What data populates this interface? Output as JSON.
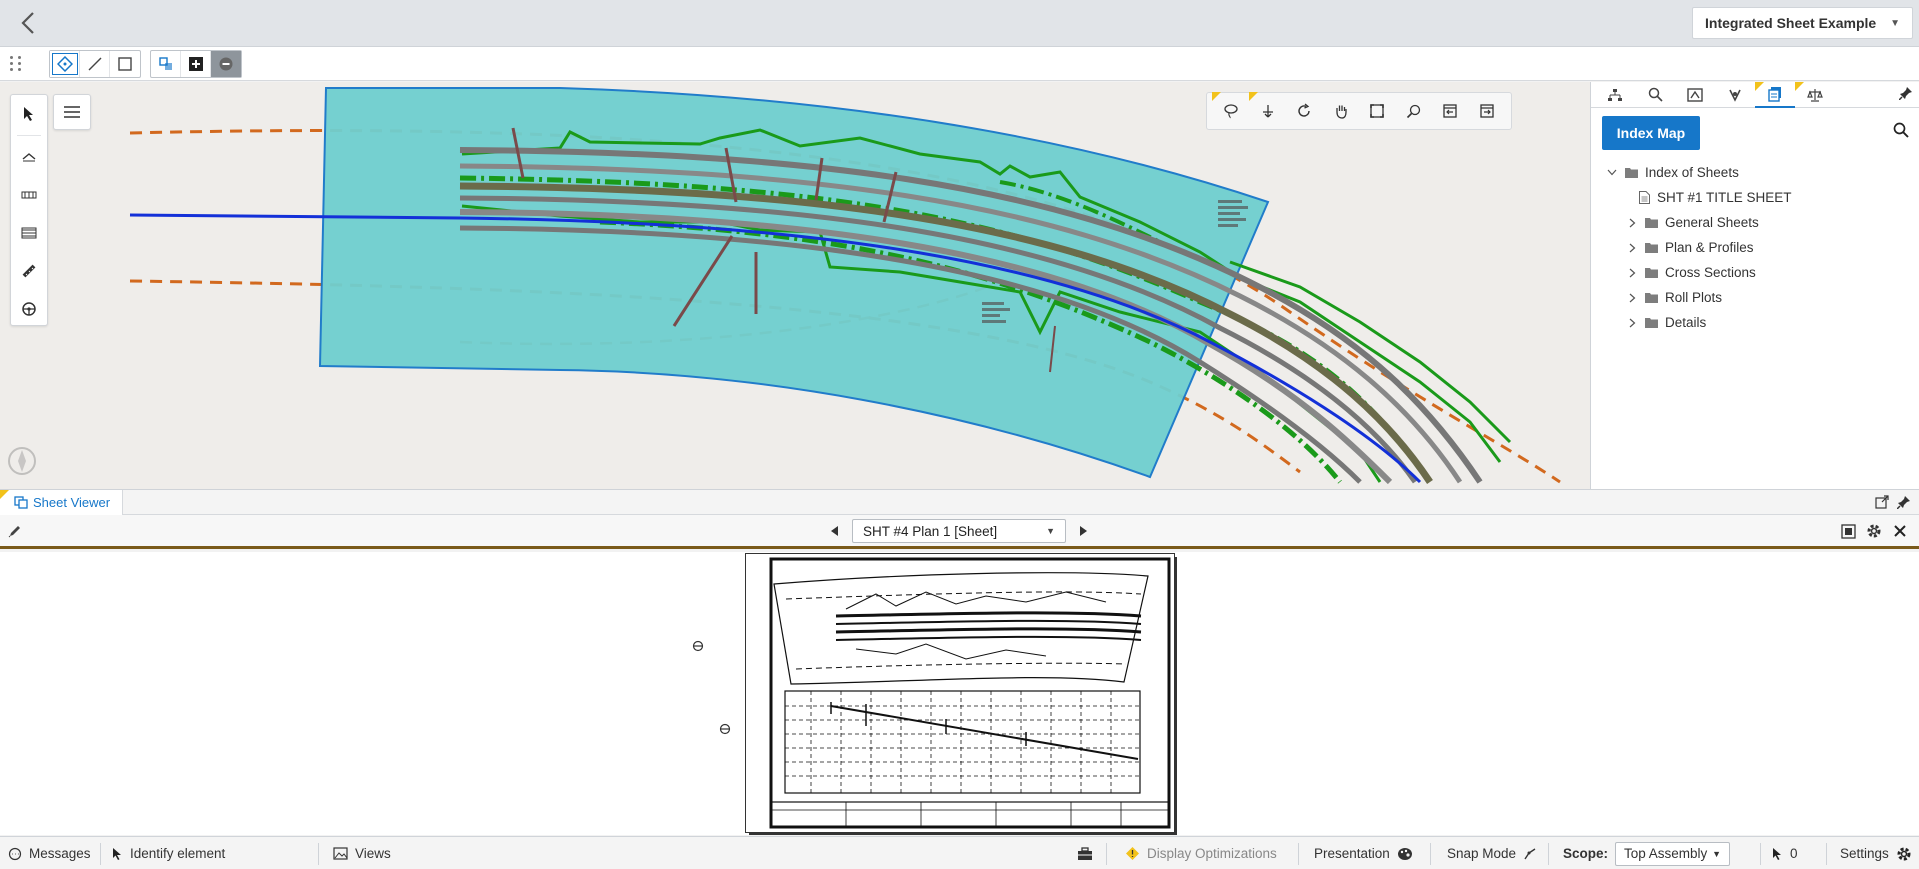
{
  "header": {
    "project_name": "Integrated Sheet Example"
  },
  "toolbar": {
    "icons": [
      "point-select-icon",
      "line-select-icon",
      "box-select-icon",
      "selection-mode-icon",
      "add-selection-icon",
      "remove-selection-icon"
    ]
  },
  "view_tools": [
    "lasso-icon",
    "walk-icon",
    "rotate-icon",
    "pan-icon",
    "fit-view-icon",
    "zoom-window-icon",
    "previous-view-icon",
    "next-view-icon"
  ],
  "right_panel": {
    "index_map_label": "Index Map",
    "tree": [
      {
        "label": "Index of Sheets",
        "level": 0,
        "type": "folder",
        "expanded": true
      },
      {
        "label": "SHT #1 TITLE SHEET",
        "level": 1,
        "type": "sheet"
      },
      {
        "label": "General Sheets",
        "level": 1,
        "type": "folder",
        "expanded": false
      },
      {
        "label": "Plan & Profiles",
        "level": 1,
        "type": "folder",
        "expanded": false
      },
      {
        "label": "Cross Sections",
        "level": 1,
        "type": "folder",
        "expanded": false
      },
      {
        "label": "Roll Plots",
        "level": 1,
        "type": "folder",
        "expanded": false
      },
      {
        "label": "Details",
        "level": 1,
        "type": "folder",
        "expanded": false
      }
    ]
  },
  "sheet_viewer": {
    "tab_label": "Sheet Viewer",
    "current_sheet": "SHT #4 Plan 1 [Sheet]"
  },
  "statusbar": {
    "messages": "Messages",
    "identify": "Identify element",
    "views": "Views",
    "display_optimizations": "Display Optimizations",
    "presentation": "Presentation",
    "snap_mode": "Snap Mode",
    "scope_label": "Scope:",
    "scope_value": "Top Assembly",
    "selection_count": "0",
    "settings": "Settings"
  },
  "colors": {
    "accent": "#1677c9",
    "sheet_fill": "#6fcfcf",
    "alignment": "#1330d8",
    "existing_ground": "#1a9a1a",
    "row_line": "#d2691e"
  }
}
